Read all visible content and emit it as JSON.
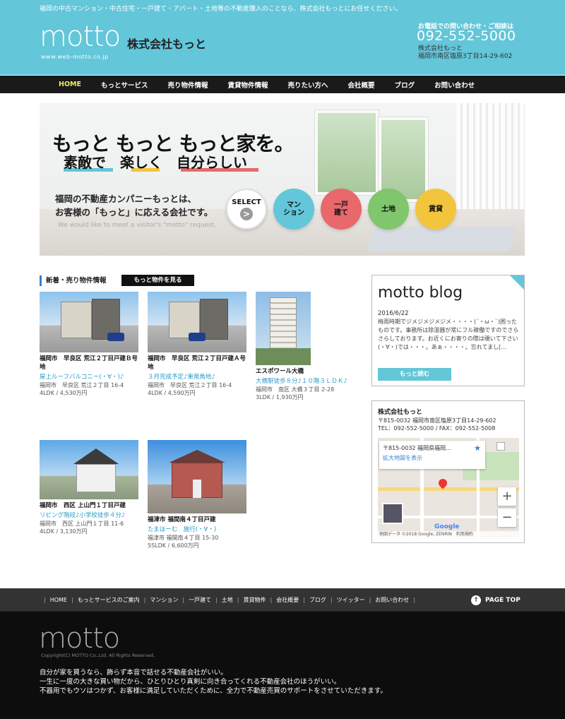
{
  "header": {
    "tagline": "福岡の中古マンション・中古住宅・一戸建て・アパート・土地等の不動産購入のことなら、株式会社もっとにお任せください。",
    "logo": "motto",
    "logo_url": "www.web-motto.co.jp",
    "company": "株式会社もっと",
    "contact_label": "お電話での問い合わせ・ご相談は",
    "phone": "092-552-5000",
    "company_small": "株式会社もっと",
    "address_small": "福岡市南区塩原3丁目14-29-602"
  },
  "nav": [
    "HOME",
    "もっとサービス",
    "売り物件情報",
    "賃貸物件情報",
    "売りたい方へ",
    "会社概要",
    "ブログ",
    "お問い合わせ"
  ],
  "hero": {
    "line1": "もっと もっと もっと家を。",
    "line2": "素敵で　楽しく　自分らしい",
    "desc1": "福岡の不動産カンパニーもっとは、",
    "desc2": "お客様の「もっと」に応える会社です。",
    "english": "We would like to meet a visitor's \"motto\" request.",
    "select": "SELECT",
    "select_arrow": ">",
    "circles": [
      "マン\nション",
      "一戸\n建て",
      "土地",
      "賃貸"
    ],
    "circle_letters": [
      "M",
      "K",
      "L",
      "R"
    ]
  },
  "news": {
    "title": "新着・売り物件情報",
    "more": "もっと物件を見る",
    "cards": [
      {
        "title": "福岡市　早良区 荒江２丁目戸建Ｂ号地",
        "desc": "屋上ルーフバルコニー(・∀・)♪",
        "addr": "福岡市　早良区 荒江２丁目 16-4",
        "spec": "4LDK / 4,530万円"
      },
      {
        "title": "福岡市　早良区 荒江２丁目戸建Ａ号地",
        "desc": "３月完成予定♪東南角地♪",
        "addr": "福岡市　早良区 荒江２丁目 16-4",
        "spec": "4LDK / 4,590万円"
      },
      {
        "title": "エスポワール大橋",
        "desc": "大橋駅徒歩８分♪１０階３ＬＤＫ♪",
        "addr": "福岡市　南区 大橋３丁目 2-28",
        "spec": "3LDK / 1,930万円"
      },
      {
        "title": "福岡市　西区 上山門１丁目戸建",
        "desc": "リビング階段♪小学校徒歩４分♪",
        "addr": "福岡市　西区 上山門１丁目 11-6",
        "spec": "4LDK / 3,130万円"
      },
      {
        "title": "福津市 福間南４丁目戸建",
        "desc": "たまほーむ　施行(・∀・)",
        "addr": "福津市 福間南４丁目 15-30",
        "spec": "5SLDK / 6,600万円"
      }
    ]
  },
  "blog": {
    "title": "motto blog",
    "date": "2016/6/22",
    "text": "梅雨時期でジメジメジメジメ・・・・(´・ω・`)困ったものです。事務所は除湿器が常にフル稼働ですのでさらさらしております。お近くにお寄りの際は覗いて下さい(・∀・)では・・・。あぁ・・・・。忘れてまし[...",
    "read_more": "もっと読む"
  },
  "company_box": {
    "name": "株式会社もっと",
    "address": "〒815-0032 福岡市南区塩原3丁目14-29-602",
    "tel": "TEL：092-552-5000 / FAX：092-552-5008",
    "map_popup": "〒815-0032 福岡県福岡...",
    "map_link": "拡大地図を表示",
    "map_plus": "+",
    "map_minus": "−",
    "map_brand": "Google",
    "map_footer": "地図データ ©2018 Google, ZENRIN　利用規約"
  },
  "footer_nav": [
    "HOME",
    "もっとサービスのご案内",
    "マンション",
    "一戸建て",
    "土地",
    "賃貸物件",
    "会社概要",
    "ブログ",
    "ツイッター",
    "お問い合わせ"
  ],
  "page_top": "PAGE TOP",
  "page_top_icon": "↑",
  "footer": {
    "logo": "motto",
    "copyright": "Copyright(C) MOTTO Co.,Ltd. All Rights Reserved.",
    "msg1": "自分が家を買うなら、飾らず本音で話せる不動産会社がいい。",
    "msg2": "一生に一度の大きな買い物だから、ひとりひとり真剣に向き合ってくれる不動産会社のほうがいい。",
    "msg3": "不器用でもウソはつかず、お客様に満足していただくために、全力で不動産売買のサポートをさせていただきます。"
  },
  "colors": {
    "brand": "#63c6d9",
    "nav_bg": "#1a1a1a",
    "active": "#f2e56b",
    "link": "#2a9ac8"
  }
}
